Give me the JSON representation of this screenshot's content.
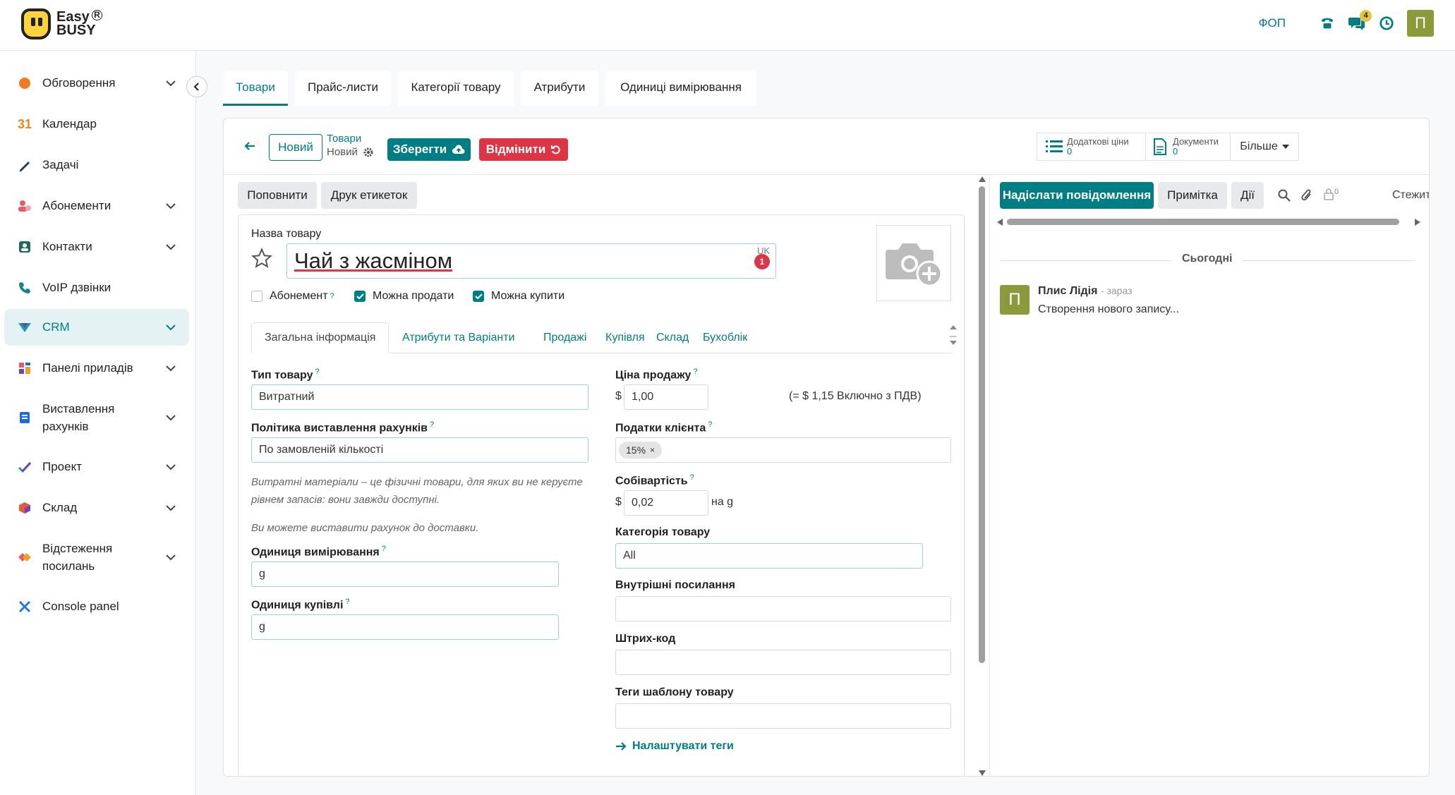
{
  "topbar": {
    "logo_line1": "Easy",
    "logo_line2": "BUSY",
    "company": "ФОП",
    "messages_count": "4",
    "avatar_letter": "П",
    "accent_color": "#017e84"
  },
  "sidebar": {
    "items": [
      {
        "label": "Обговорення",
        "icon": "chat-bubble-icon",
        "has_chevron": true
      },
      {
        "label": "Календар",
        "icon": "calendar-icon",
        "has_chevron": false
      },
      {
        "label": "Задачі",
        "icon": "pencil-icon",
        "has_chevron": false
      },
      {
        "label": "Абонементи",
        "icon": "subscription-icon",
        "has_chevron": true
      },
      {
        "label": "Контакти",
        "icon": "contacts-icon",
        "has_chevron": true
      },
      {
        "label": "VoIP дзвінки",
        "icon": "phone-icon",
        "has_chevron": false
      },
      {
        "label": "CRM",
        "icon": "crm-icon",
        "has_chevron": true
      },
      {
        "label": "Панелі приладів",
        "icon": "dashboard-icon",
        "has_chevron": true
      },
      {
        "label": "Виставлення рахунків",
        "icon": "invoice-icon",
        "has_chevron": true
      },
      {
        "label": "Проект",
        "icon": "project-icon",
        "has_chevron": true
      },
      {
        "label": "Склад",
        "icon": "warehouse-icon",
        "has_chevron": true
      },
      {
        "label": "Відстеження посилань",
        "icon": "link-tracker-icon",
        "has_chevron": true
      },
      {
        "label": "Console panel",
        "icon": "console-icon",
        "has_chevron": false
      }
    ]
  },
  "tabs": [
    "Товари",
    "Прайс-листи",
    "Категорії товару",
    "Атрибути",
    "Одиниці вимірювання"
  ],
  "control_panel": {
    "new_button": "Новий",
    "breadcrumb_parent": "Товари",
    "breadcrumb_current": "Новий",
    "save_button": "Зберегти",
    "discard_button": "Відмінити",
    "extra_prices_label": "Додаткові ціни",
    "extra_prices_count": "0",
    "documents_label": "Документи",
    "documents_count": "0",
    "more_button": "Більше"
  },
  "form": {
    "replenish_button": "Поповнити",
    "print_labels_button": "Друк етикеток",
    "name_label": "Назва товару",
    "name_value": "Чай з жасміном",
    "lang_code": "UK",
    "error_count": "1",
    "subscription_label": "Абонемент",
    "subscription_checked": false,
    "can_sell_label": "Можна продати",
    "can_sell_checked": true,
    "can_buy_label": "Можна купити",
    "can_buy_checked": true,
    "notebook_tabs": [
      "Загальна інформація",
      "Атрибути та Варіанти",
      "Продажі",
      "Купівля",
      "Склад",
      "Бухоблік"
    ],
    "product_type_label": "Тип товару",
    "product_type_value": "Витратний",
    "invoice_policy_label": "Політика виставлення рахунків",
    "invoice_policy_value": "По замовленій кількості",
    "help_consumable": "Витратні матеріали – це фізичні товари, для яких ви не керуєте рівнем запасів: вони завжди доступні.",
    "help_invoice": "Ви можете виставити рахунок до доставки.",
    "uom_label": "Одиниця вимірювання",
    "uom_value": "g",
    "purchase_uom_label": "Одиниця купівлі",
    "purchase_uom_value": "g",
    "sales_price_label": "Ціна продажу",
    "currency_symbol": "$",
    "sales_price_value": "1,00",
    "tax_included_text": "(= $ 1,15 Включно з ПДВ)",
    "customer_taxes_label": "Податки клієнта",
    "tax_tag": "15%",
    "cost_label": "Собівартість",
    "cost_value": "0,02",
    "cost_unit_text": "на g",
    "category_label": "Категорія товару",
    "category_value": "All",
    "internal_ref_label": "Внутрішні посилання",
    "barcode_label": "Штрих-код",
    "template_tags_label": "Теги шаблону товару",
    "configure_tags_link": "Налаштувати теги"
  },
  "chatter": {
    "send_message_button": "Надіслати повідомлення",
    "log_note_button": "Примітка",
    "activities_button": "Дії",
    "followers_count": "0",
    "follow_label": "Стежити",
    "date_separator": "Сьогодні",
    "message_author": "Плис Лідія",
    "message_time": "- зараз",
    "message_body": "Створення нового запису...",
    "author_initial": "П"
  }
}
